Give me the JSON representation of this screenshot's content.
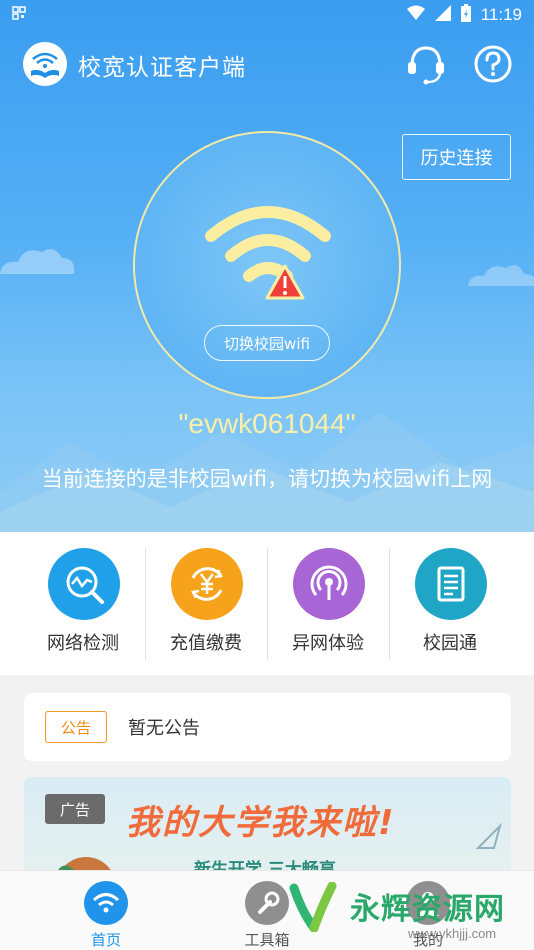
{
  "status_bar": {
    "time": "11:19",
    "left_icon": "qr-code-icon",
    "icons": [
      "wifi-icon",
      "signal-icon",
      "battery-charging-icon"
    ]
  },
  "app": {
    "title": "校宽认证客户端"
  },
  "header_actions": {
    "support_icon": "headset-icon",
    "help_icon": "question-icon"
  },
  "hero": {
    "history_button": "历史连接",
    "switch_button": "切换校园wifi",
    "ssid": "\"evwk061044\"",
    "notice": "当前连接的是非校园wifi，请切换为校园wifi上网",
    "wifi_icon": "wifi-warning-icon",
    "colors": {
      "wifi": "#fbeea0",
      "warning": "#ee3f3a",
      "ring": "#f3e9a6"
    }
  },
  "features": [
    {
      "label": "网络检测",
      "icon": "network-check-icon",
      "color": "#1fa0e8"
    },
    {
      "label": "充值缴费",
      "icon": "yen-recharge-icon",
      "color": "#f7a21b"
    },
    {
      "label": "异网体验",
      "icon": "broadcast-icon",
      "color": "#a765d6"
    },
    {
      "label": "校园通",
      "icon": "document-icon",
      "color": "#1fa5c5"
    }
  ],
  "announcement": {
    "tag": "公告",
    "text": "暂无公告"
  },
  "banner": {
    "tag": "广告",
    "headline": "我的大学我来啦!",
    "sub": "新生开学 三大畅享"
  },
  "tabs": [
    {
      "label": "首页",
      "icon": "wifi-home-icon",
      "active": true
    },
    {
      "label": "工具箱",
      "icon": "wrench-icon",
      "active": false
    },
    {
      "label": "我的",
      "icon": "user-icon",
      "active": false
    }
  ],
  "watermark": {
    "text": "永辉资源网",
    "url": "www.ykhjjj.com"
  }
}
